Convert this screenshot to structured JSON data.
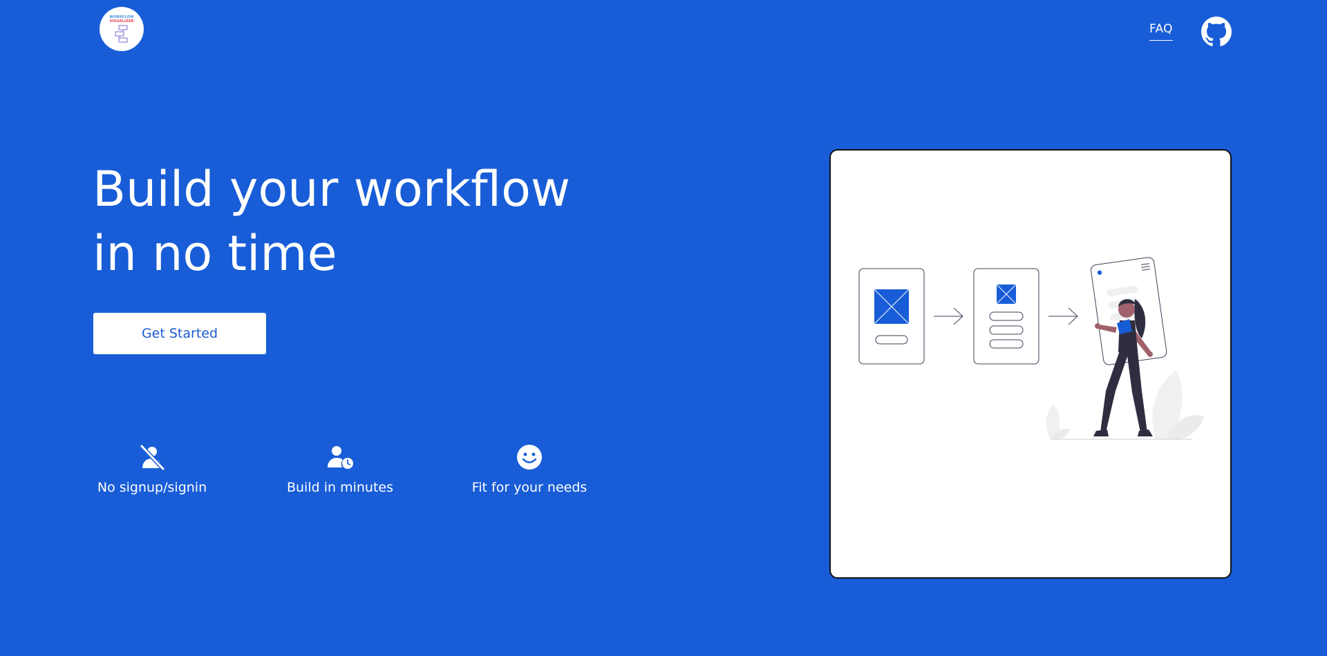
{
  "header": {
    "logo": {
      "line1": "WORKFLOW",
      "line2": "VISUALIZER",
      "icon": "workflow-diagram-icon"
    },
    "faq_label": "FAQ",
    "github_icon": "github-icon"
  },
  "hero": {
    "title_line1": "Build your workflow",
    "title_line2": "in no time",
    "cta_label": "Get Started"
  },
  "features": [
    {
      "icon": "user-slash-icon",
      "label": "No signup/signin"
    },
    {
      "icon": "user-clock-icon",
      "label": "Build in minutes"
    },
    {
      "icon": "smile-icon",
      "label": "Fit for your needs"
    }
  ],
  "illustration": {
    "icon": "workflow-illustration"
  },
  "colors": {
    "background": "#185dd7",
    "accent": "#1a5bd0",
    "card": "#ffffff",
    "text": "#ffffff"
  }
}
